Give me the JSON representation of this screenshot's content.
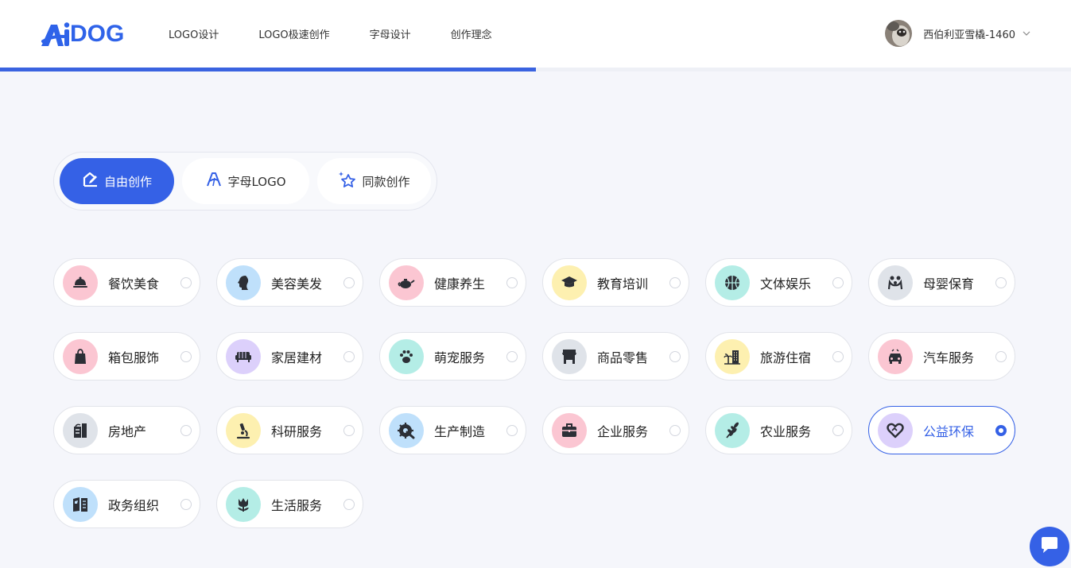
{
  "header": {
    "logo_text": "DOG",
    "nav": [
      "LOGO设计",
      "LOGO极速创作",
      "字母设计",
      "创作理念"
    ],
    "username": "西伯利亚雪橇-1460",
    "progress": 0.5
  },
  "tabs": [
    {
      "label": "自由创作",
      "icon": "edit-house-icon",
      "active": true
    },
    {
      "label": "字母LOGO",
      "icon": "letter-a-icon",
      "active": false
    },
    {
      "label": "同款创作",
      "icon": "star-sparkle-icon",
      "active": false
    }
  ],
  "categories": [
    {
      "label": "餐饮美食",
      "icon": "cloche-icon",
      "color": "#fbc6d2",
      "selected": false
    },
    {
      "label": "美容美发",
      "icon": "face-profile-icon",
      "color": "#bfe0fb",
      "selected": false
    },
    {
      "label": "健康养生",
      "icon": "teapot-icon",
      "color": "#fbc6d2",
      "selected": false
    },
    {
      "label": "教育培训",
      "icon": "graduation-cap-icon",
      "color": "#fdf0b0",
      "selected": false
    },
    {
      "label": "文体娱乐",
      "icon": "basketball-icon",
      "color": "#b4ede6",
      "selected": false
    },
    {
      "label": "母婴保育",
      "icon": "mother-baby-icon",
      "color": "#dfe3e9",
      "selected": false
    },
    {
      "label": "箱包服饰",
      "icon": "shopping-bag-icon",
      "color": "#fbc6d2",
      "selected": false
    },
    {
      "label": "家居建材",
      "icon": "sofa-icon",
      "color": "#dcd0fb",
      "selected": false
    },
    {
      "label": "萌宠服务",
      "icon": "paw-icon",
      "color": "#b4ede6",
      "selected": false
    },
    {
      "label": "商品零售",
      "icon": "storefront-icon",
      "color": "#dfe3e9",
      "selected": false
    },
    {
      "label": "旅游住宿",
      "icon": "hotel-palm-icon",
      "color": "#fdf0b0",
      "selected": false
    },
    {
      "label": "汽车服务",
      "icon": "car-icon",
      "color": "#fbc6d2",
      "selected": false
    },
    {
      "label": "房地产",
      "icon": "building-icon",
      "color": "#dfe3e9",
      "selected": false
    },
    {
      "label": "科研服务",
      "icon": "microscope-icon",
      "color": "#fdf0b0",
      "selected": false
    },
    {
      "label": "生产制造",
      "icon": "gear-wrench-icon",
      "color": "#bfe0fb",
      "selected": false
    },
    {
      "label": "企业服务",
      "icon": "briefcase-icon",
      "color": "#fbc6d2",
      "selected": false
    },
    {
      "label": "农业服务",
      "icon": "wheat-icon",
      "color": "#b4ede6",
      "selected": false
    },
    {
      "label": "公益环保",
      "icon": "heart-icon",
      "color": "#dcd0fb",
      "selected": true
    },
    {
      "label": "政务组织",
      "icon": "flag-book-icon",
      "color": "#bfe0fb",
      "selected": false
    },
    {
      "label": "生活服务",
      "icon": "tulip-icon",
      "color": "#b4ede6",
      "selected": false
    }
  ],
  "colors": {
    "accent": "#3561e6",
    "background": "#f5f6fb"
  }
}
